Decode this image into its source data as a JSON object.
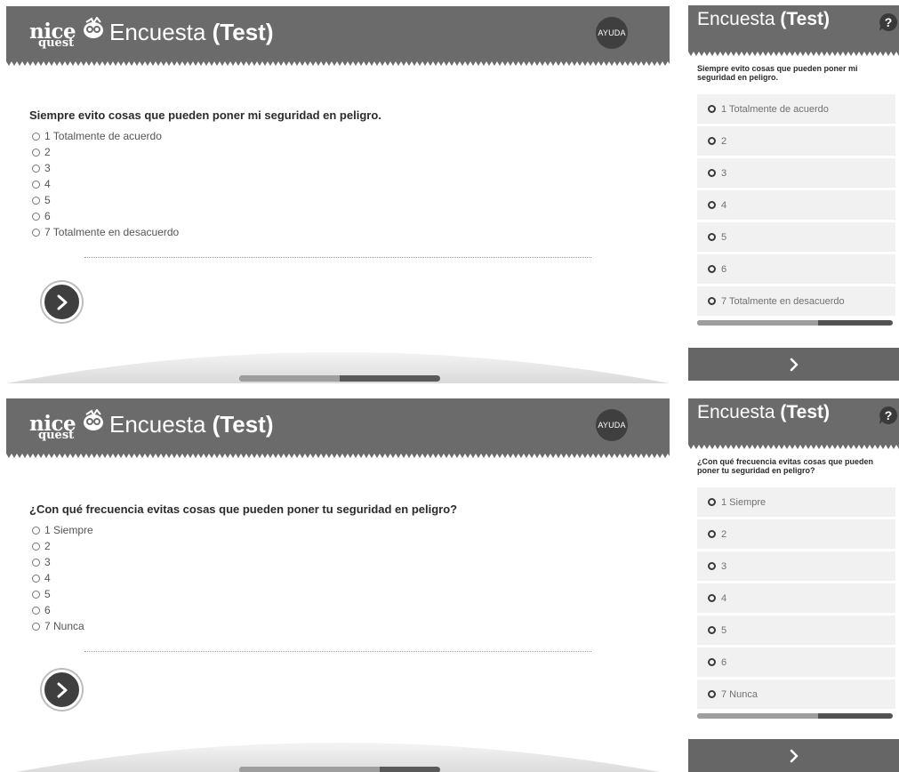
{
  "brand": {
    "logo_top": "nice",
    "logo_bottom": "quest",
    "logo_icon": "owl-logo-icon"
  },
  "screens": {
    "desktop_1": {
      "title_plain": "Encuesta ",
      "title_bold": "(Test)",
      "help_label": "AYUDA",
      "question": "Siempre evito cosas que pueden poner mi seguridad en peligro.",
      "options": [
        "1 Totalmente de acuerdo",
        "2",
        "3",
        "4",
        "5",
        "6",
        "7 Totalmente en desacuerdo"
      ],
      "next_icon": "chevron-right-icon",
      "progress": 0.5
    },
    "desktop_2": {
      "title_plain": "Encuesta ",
      "title_bold": "(Test)",
      "help_label": "AYUDA",
      "question": "¿Con qué frecuencia evitas cosas que pueden poner tu seguridad en peligro?",
      "options": [
        "1 Siempre",
        "2",
        "3",
        "4",
        "5",
        "6",
        "7 Nunca"
      ],
      "next_icon": "chevron-right-icon",
      "progress": 0.7
    },
    "mobile_1": {
      "title_plain": "Encuesta ",
      "title_bold": "(Test)",
      "help_icon": "question-mark-icon",
      "question": "Siempre evito cosas que pueden poner mi seguridad en peligro.",
      "options": [
        "1 Totalmente de acuerdo",
        "2",
        "3",
        "4",
        "5",
        "6",
        "7 Totalmente en desacuerdo"
      ],
      "next_icon": "chevron-right-icon",
      "progress": 0.62
    },
    "mobile_2": {
      "title_plain": "Encuesta ",
      "title_bold": "(Test)",
      "help_icon": "question-mark-icon",
      "question": "¿Con qué frecuencia evitas cosas que pueden poner tu seguridad en peligro?",
      "options": [
        "1 Siempre",
        "2",
        "3",
        "4",
        "5",
        "6",
        "7 Nunca"
      ],
      "next_icon": "chevron-right-icon",
      "progress": 0.62
    }
  },
  "colors": {
    "header": "#6b6b6b",
    "dark": "#3f3f3f",
    "option_bg": "#f1f1f1"
  }
}
